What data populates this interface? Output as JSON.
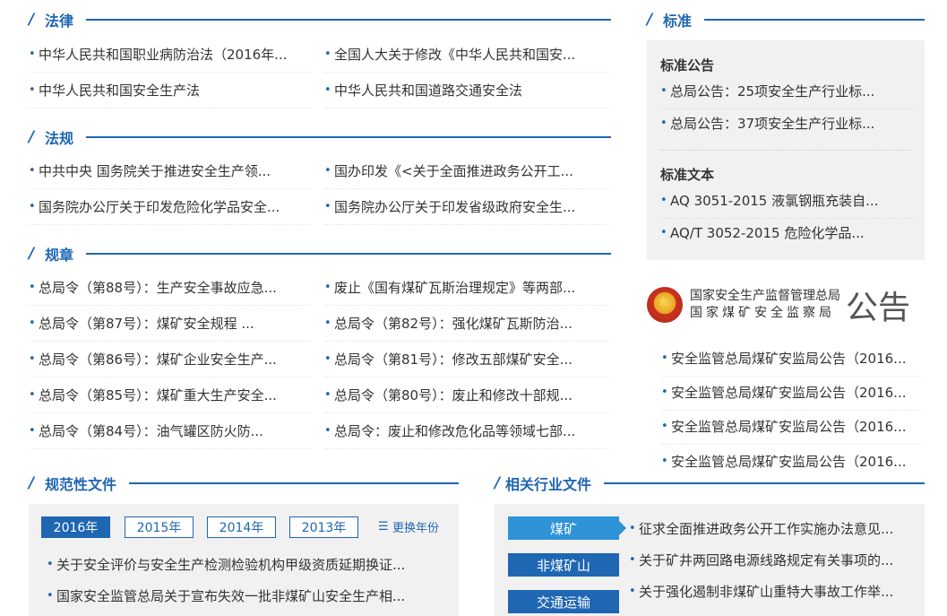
{
  "laws": {
    "title": "法律",
    "items": [
      "中华人民共和国职业病防治法（2016年...",
      "全国人大关于修改《中华人民共和国安...",
      "中华人民共和国安全生产法",
      "中华人民共和国道路交通安全法"
    ]
  },
  "regulations": {
    "title": "法规",
    "items": [
      "中共中央 国务院关于推进安全生产领...",
      "国办印发《<关于全面推进政务公开工...",
      "国务院办公厅关于印发危险化学品安全...",
      "国务院办公厅关于印发省级政府安全生..."
    ]
  },
  "rules": {
    "title": "规章",
    "items": [
      "总局令（第88号）：生产安全事故应急...",
      "废止《国有煤矿瓦斯治理规定》等两部...",
      "总局令（第87号）：煤矿安全规程 ...",
      "总局令（第82号）：强化煤矿瓦斯防治...",
      "总局令（第86号）：煤矿企业安全生产...",
      "总局令（第81号）：修改五部煤矿安全...",
      "总局令（第85号）：煤矿重大生产安全...",
      "总局令（第80号）：废止和修改十部规...",
      "总局令（第84号）：油气罐区防火防...",
      "总局令：废止和修改危化品等领域七部..."
    ]
  },
  "standards": {
    "title": "标准",
    "announcements_title": "标准公告",
    "announcements": [
      "总局公告：25项安全生产行业标...",
      "总局公告：37项安全生产行业标..."
    ],
    "texts_title": "标准文本",
    "texts": [
      "AQ 3051-2015 液氯钢瓶充装自...",
      "AQ/T 3052-2015 危险化学品..."
    ]
  },
  "announcements": {
    "agency_line1": "国家安全生产监督管理总局",
    "agency_line2": "国家煤矿安全监察局",
    "big_label": "公告",
    "items": [
      "安全监管总局煤矿安监局公告（2016...",
      "安全监管总局煤矿安监局公告（2016...",
      "安全监管总局煤矿安监局公告（2016...",
      "安全监管总局煤矿安监局公告（2016..."
    ]
  },
  "normative": {
    "title": "规范性文件",
    "years": [
      "2016年",
      "2015年",
      "2014年",
      "2013年"
    ],
    "active_year": "2016年",
    "switch_label": "更换年份",
    "items": [
      "关于安全评价与安全生产检测检验机构甲级资质延期换证...",
      "国家安全监管总局关于宣布失效一批非煤矿山安全生产相..."
    ]
  },
  "industry": {
    "title": "相关行业文件",
    "categories": [
      "煤矿",
      "非煤矿山",
      "交通运输"
    ],
    "active_category": "煤矿",
    "items": [
      "征求全面推进政务公开工作实施办法意见...",
      "关于矿井两回路电源线路规定有关事项的...",
      "关于强化遏制非煤矿山重特大事故工作举..."
    ]
  },
  "colors": {
    "accent": "#1f66b3",
    "tab_active": "#2e93d7",
    "panel_bg": "#f1f1f1"
  }
}
